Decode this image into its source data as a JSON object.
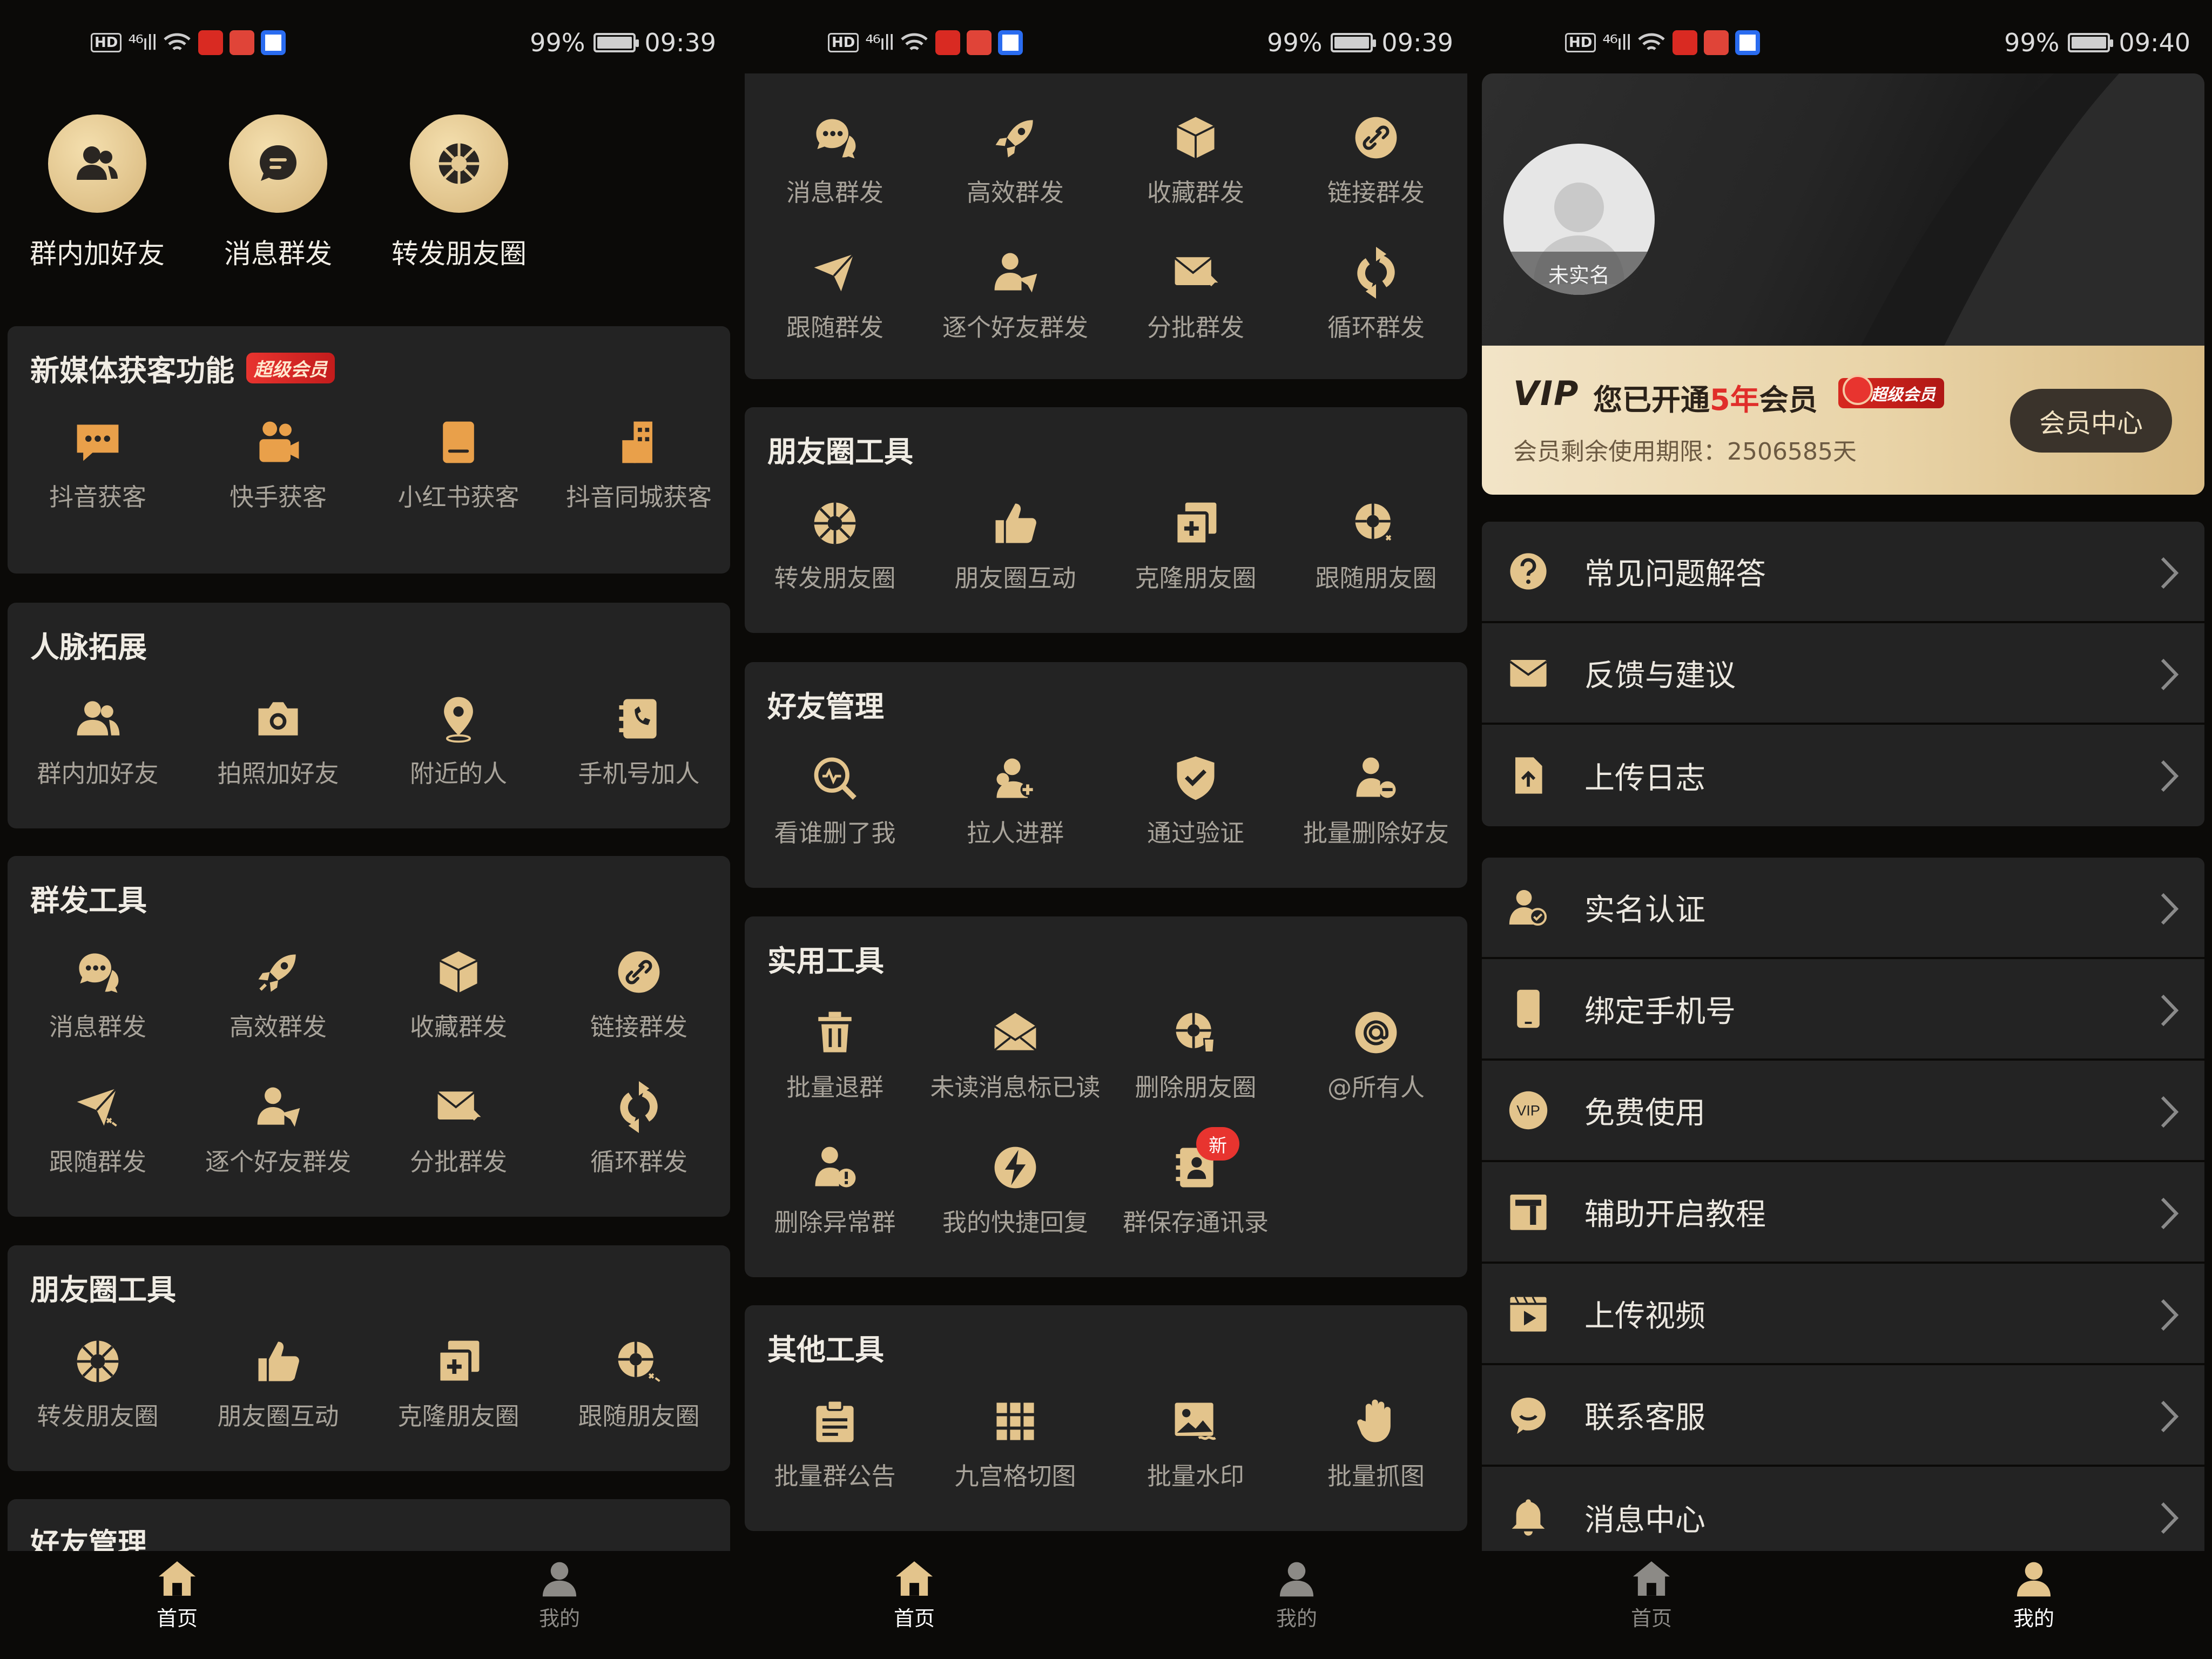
{
  "status": [
    {
      "battery": "99%",
      "time": "09:39"
    },
    {
      "battery": "99%",
      "time": "09:39"
    },
    {
      "battery": "99%",
      "time": "09:40"
    }
  ],
  "status_icons": {
    "hd": "HD",
    "signal": "⁴⁶ıll",
    "wifi": "wifi-icon"
  },
  "colors": {
    "gold": "#e3c48c",
    "gold_light": "#f4dfae",
    "card": "#232323",
    "bg": "#0b0a08",
    "red": "#e8342f"
  },
  "quick": [
    {
      "label": "群内加好友",
      "icon": "group-add-icon"
    },
    {
      "label": "消息群发",
      "icon": "message-icon"
    },
    {
      "label": "转发朋友圈",
      "icon": "aperture-icon"
    }
  ],
  "panel1": {
    "media": {
      "title": "新媒体获客功能",
      "badge": "超级会员",
      "items": [
        {
          "label": "抖音获客",
          "icon": "chat-bubble-icon"
        },
        {
          "label": "快手获客",
          "icon": "camera-person-icon"
        },
        {
          "label": "小红书获客",
          "icon": "book-icon"
        },
        {
          "label": "抖音同城获客",
          "icon": "building-icon"
        }
      ]
    },
    "network": {
      "title": "人脉拓展",
      "items": [
        {
          "label": "群内加好友",
          "icon": "group-add-icon"
        },
        {
          "label": "拍照加好友",
          "icon": "camera-icon"
        },
        {
          "label": "附近的人",
          "icon": "location-pin-icon"
        },
        {
          "label": "手机号加人",
          "icon": "phone-book-icon"
        }
      ]
    },
    "broadcast": {
      "title": "群发工具",
      "items": [
        {
          "label": "消息群发",
          "icon": "chat-dots-icon"
        },
        {
          "label": "高效群发",
          "icon": "rocket-icon"
        },
        {
          "label": "收藏群发",
          "icon": "box-icon"
        },
        {
          "label": "链接群发",
          "icon": "link-icon"
        },
        {
          "label": "跟随群发",
          "icon": "send-plane-icon"
        },
        {
          "label": "逐个好友群发",
          "icon": "user-send-icon"
        },
        {
          "label": "分批群发",
          "icon": "mail-forward-icon"
        },
        {
          "label": "循环群发",
          "icon": "cycle-icon"
        }
      ]
    },
    "moments": {
      "title": "朋友圈工具",
      "items": [
        {
          "label": "转发朋友圈",
          "icon": "aperture-icon"
        },
        {
          "label": "朋友圈互动",
          "icon": "thumbs-up-icon"
        },
        {
          "label": "克隆朋友圈",
          "icon": "clone-icon"
        },
        {
          "label": "跟随朋友圈",
          "icon": "aperture-follow-icon"
        }
      ]
    },
    "friends": {
      "title": "好友管理"
    }
  },
  "panel2": {
    "broadcast": {
      "items": [
        {
          "label": "消息群发",
          "icon": "chat-dots-icon"
        },
        {
          "label": "高效群发",
          "icon": "rocket-icon"
        },
        {
          "label": "收藏群发",
          "icon": "box-icon"
        },
        {
          "label": "链接群发",
          "icon": "link-icon"
        },
        {
          "label": "跟随群发",
          "icon": "send-plane-icon"
        },
        {
          "label": "逐个好友群发",
          "icon": "user-send-icon"
        },
        {
          "label": "分批群发",
          "icon": "mail-forward-icon"
        },
        {
          "label": "循环群发",
          "icon": "cycle-icon"
        }
      ]
    },
    "moments": {
      "title": "朋友圈工具",
      "items": [
        {
          "label": "转发朋友圈",
          "icon": "aperture-icon"
        },
        {
          "label": "朋友圈互动",
          "icon": "thumbs-up-icon"
        },
        {
          "label": "克隆朋友圈",
          "icon": "clone-icon"
        },
        {
          "label": "跟随朋友圈",
          "icon": "aperture-follow-icon"
        }
      ]
    },
    "friends": {
      "title": "好友管理",
      "items": [
        {
          "label": "看谁删了我",
          "icon": "search-pulse-icon"
        },
        {
          "label": "拉人进群",
          "icon": "users-add-icon"
        },
        {
          "label": "通过验证",
          "icon": "shield-check-icon"
        },
        {
          "label": "批量删除好友",
          "icon": "user-remove-icon"
        }
      ]
    },
    "utility": {
      "title": "实用工具",
      "items": [
        {
          "label": "批量退群",
          "icon": "trash-icon"
        },
        {
          "label": "未读消息标已读",
          "icon": "mail-open-icon"
        },
        {
          "label": "删除朋友圈",
          "icon": "aperture-delete-icon"
        },
        {
          "label": "@所有人",
          "icon": "at-icon"
        },
        {
          "label": "删除异常群",
          "icon": "user-warning-icon"
        },
        {
          "label": "我的快捷回复",
          "icon": "bolt-icon"
        },
        {
          "label": "群保存通讯录",
          "icon": "contacts-icon",
          "badge": "新"
        }
      ]
    },
    "other": {
      "title": "其他工具",
      "items": [
        {
          "label": "批量群公告",
          "icon": "clipboard-icon"
        },
        {
          "label": "九宫格切图",
          "icon": "grid-icon"
        },
        {
          "label": "批量水印",
          "icon": "image-icon"
        },
        {
          "label": "批量抓图",
          "icon": "hand-icon"
        }
      ]
    }
  },
  "profile": {
    "avatar_tag": "未实名",
    "vip_logo": "VIP",
    "vip_title_pre": "您已开通",
    "vip_title_hl": "5年",
    "vip_title_post": "会员",
    "vip_badge": "超级会员",
    "vip_sub": "会员剩余使用期限：2506585天",
    "vip_button": "会员中心",
    "group1": [
      {
        "label": "常见问题解答",
        "icon": "question-icon"
      },
      {
        "label": "反馈与建议",
        "icon": "envelope-icon"
      },
      {
        "label": "上传日志",
        "icon": "file-upload-icon"
      }
    ],
    "group2": [
      {
        "label": "实名认证",
        "icon": "user-verified-icon"
      },
      {
        "label": "绑定手机号",
        "icon": "phone-icon"
      },
      {
        "label": "免费使用",
        "icon": "vip-circle-icon"
      },
      {
        "label": "辅助开启教程",
        "icon": "tutorial-icon"
      },
      {
        "label": "上传视频",
        "icon": "video-icon"
      },
      {
        "label": "联系客服",
        "icon": "service-icon"
      },
      {
        "label": "消息中心",
        "icon": "bell-icon"
      }
    ]
  },
  "tabs": {
    "home": "首页",
    "mine": "我的"
  }
}
